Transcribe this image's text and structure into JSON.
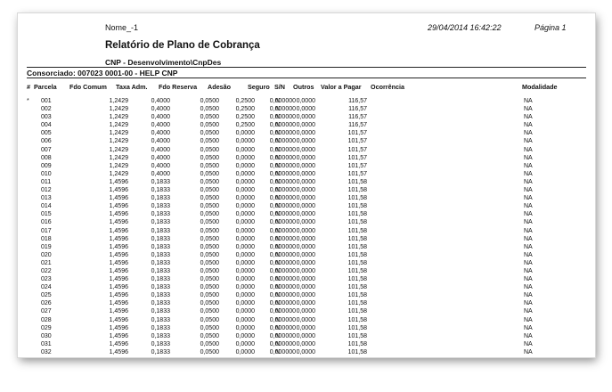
{
  "report": {
    "doc_name": "Nome_-1",
    "datetime": "29/04/2014 16:42:22",
    "page": "Página 1",
    "title": "Relatório de Plano de Cobrança",
    "subtitle": "CNP - Desenvolvimento\\CnpDes",
    "consorciado": "Consorciado: 007023 0001-00 - HELP CNP"
  },
  "columns": {
    "hash": "#",
    "parcela": "Parcela",
    "fdo_comum": "Fdo Comum",
    "taxa_adm": "Taxa Adm.",
    "fdo_reserva": "Fdo Reserva",
    "adesao": "Adesão",
    "seguro": "Seguro",
    "sn": "S/N",
    "outros": "Outros",
    "valor_pagar": "Valor a Pagar",
    "ocorrencia": "Ocorrência",
    "modalidade": "Modalidade"
  },
  "rows": [
    {
      "mark": "*",
      "parcela": "001",
      "fdo_comum": "1,2429",
      "taxa_adm": "0,4000",
      "fdo_reserva": "0,0500",
      "adesao": "0,2500",
      "seguro": "0,000000",
      "sn": "N",
      "outros": "0,0000",
      "valor": "116,57",
      "ocorrencia": "",
      "modalidade": "NA"
    },
    {
      "mark": "",
      "parcela": "002",
      "fdo_comum": "1,2429",
      "taxa_adm": "0,4000",
      "fdo_reserva": "0,0500",
      "adesao": "0,2500",
      "seguro": "0,000000",
      "sn": "N",
      "outros": "0,0000",
      "valor": "116,57",
      "ocorrencia": "",
      "modalidade": "NA"
    },
    {
      "mark": "",
      "parcela": "003",
      "fdo_comum": "1,2429",
      "taxa_adm": "0,4000",
      "fdo_reserva": "0,0500",
      "adesao": "0,2500",
      "seguro": "0,000000",
      "sn": "N",
      "outros": "0,0000",
      "valor": "116,57",
      "ocorrencia": "",
      "modalidade": "NA"
    },
    {
      "mark": "",
      "parcela": "004",
      "fdo_comum": "1,2429",
      "taxa_adm": "0,4000",
      "fdo_reserva": "0,0500",
      "adesao": "0,2500",
      "seguro": "0,000000",
      "sn": "N",
      "outros": "0,0000",
      "valor": "116,57",
      "ocorrencia": "",
      "modalidade": "NA"
    },
    {
      "mark": "",
      "parcela": "005",
      "fdo_comum": "1,2429",
      "taxa_adm": "0,4000",
      "fdo_reserva": "0,0500",
      "adesao": "0,0000",
      "seguro": "0,000000",
      "sn": "N",
      "outros": "0,0000",
      "valor": "101,57",
      "ocorrencia": "",
      "modalidade": "NA"
    },
    {
      "mark": "",
      "parcela": "006",
      "fdo_comum": "1,2429",
      "taxa_adm": "0,4000",
      "fdo_reserva": "0,0500",
      "adesao": "0,0000",
      "seguro": "0,000000",
      "sn": "N",
      "outros": "0,0000",
      "valor": "101,57",
      "ocorrencia": "",
      "modalidade": "NA"
    },
    {
      "mark": "",
      "parcela": "007",
      "fdo_comum": "1,2429",
      "taxa_adm": "0,4000",
      "fdo_reserva": "0,0500",
      "adesao": "0,0000",
      "seguro": "0,000000",
      "sn": "N",
      "outros": "0,0000",
      "valor": "101,57",
      "ocorrencia": "",
      "modalidade": "NA"
    },
    {
      "mark": "",
      "parcela": "008",
      "fdo_comum": "1,2429",
      "taxa_adm": "0,4000",
      "fdo_reserva": "0,0500",
      "adesao": "0,0000",
      "seguro": "0,000000",
      "sn": "N",
      "outros": "0,0000",
      "valor": "101,57",
      "ocorrencia": "",
      "modalidade": "NA"
    },
    {
      "mark": "",
      "parcela": "009",
      "fdo_comum": "1,2429",
      "taxa_adm": "0,4000",
      "fdo_reserva": "0,0500",
      "adesao": "0,0000",
      "seguro": "0,000000",
      "sn": "N",
      "outros": "0,0000",
      "valor": "101,57",
      "ocorrencia": "",
      "modalidade": "NA"
    },
    {
      "mark": "",
      "parcela": "010",
      "fdo_comum": "1,2429",
      "taxa_adm": "0,4000",
      "fdo_reserva": "0,0500",
      "adesao": "0,0000",
      "seguro": "0,000000",
      "sn": "N",
      "outros": "0,0000",
      "valor": "101,57",
      "ocorrencia": "",
      "modalidade": "NA"
    },
    {
      "mark": "",
      "parcela": "011",
      "fdo_comum": "1,4596",
      "taxa_adm": "0,1833",
      "fdo_reserva": "0,0500",
      "adesao": "0,0000",
      "seguro": "0,000000",
      "sn": "N",
      "outros": "0,0000",
      "valor": "101,58",
      "ocorrencia": "",
      "modalidade": "NA"
    },
    {
      "mark": "",
      "parcela": "012",
      "fdo_comum": "1,4596",
      "taxa_adm": "0,1833",
      "fdo_reserva": "0,0500",
      "adesao": "0,0000",
      "seguro": "0,000000",
      "sn": "N",
      "outros": "0,0000",
      "valor": "101,58",
      "ocorrencia": "",
      "modalidade": "NA"
    },
    {
      "mark": "",
      "parcela": "013",
      "fdo_comum": "1,4596",
      "taxa_adm": "0,1833",
      "fdo_reserva": "0,0500",
      "adesao": "0,0000",
      "seguro": "0,000000",
      "sn": "N",
      "outros": "0,0000",
      "valor": "101,58",
      "ocorrencia": "",
      "modalidade": "NA"
    },
    {
      "mark": "",
      "parcela": "014",
      "fdo_comum": "1,4596",
      "taxa_adm": "0,1833",
      "fdo_reserva": "0,0500",
      "adesao": "0,0000",
      "seguro": "0,000000",
      "sn": "N",
      "outros": "0,0000",
      "valor": "101,58",
      "ocorrencia": "",
      "modalidade": "NA"
    },
    {
      "mark": "",
      "parcela": "015",
      "fdo_comum": "1,4596",
      "taxa_adm": "0,1833",
      "fdo_reserva": "0,0500",
      "adesao": "0,0000",
      "seguro": "0,000000",
      "sn": "N",
      "outros": "0,0000",
      "valor": "101,58",
      "ocorrencia": "",
      "modalidade": "NA"
    },
    {
      "mark": "",
      "parcela": "016",
      "fdo_comum": "1,4596",
      "taxa_adm": "0,1833",
      "fdo_reserva": "0,0500",
      "adesao": "0,0000",
      "seguro": "0,000000",
      "sn": "N",
      "outros": "0,0000",
      "valor": "101,58",
      "ocorrencia": "",
      "modalidade": "NA"
    },
    {
      "mark": "",
      "parcela": "017",
      "fdo_comum": "1,4596",
      "taxa_adm": "0,1833",
      "fdo_reserva": "0,0500",
      "adesao": "0,0000",
      "seguro": "0,000000",
      "sn": "N",
      "outros": "0,0000",
      "valor": "101,58",
      "ocorrencia": "",
      "modalidade": "NA"
    },
    {
      "mark": "",
      "parcela": "018",
      "fdo_comum": "1,4596",
      "taxa_adm": "0,1833",
      "fdo_reserva": "0,0500",
      "adesao": "0,0000",
      "seguro": "0,000000",
      "sn": "N",
      "outros": "0,0000",
      "valor": "101,58",
      "ocorrencia": "",
      "modalidade": "NA"
    },
    {
      "mark": "",
      "parcela": "019",
      "fdo_comum": "1,4596",
      "taxa_adm": "0,1833",
      "fdo_reserva": "0,0500",
      "adesao": "0,0000",
      "seguro": "0,000000",
      "sn": "N",
      "outros": "0,0000",
      "valor": "101,58",
      "ocorrencia": "",
      "modalidade": "NA"
    },
    {
      "mark": "",
      "parcela": "020",
      "fdo_comum": "1,4596",
      "taxa_adm": "0,1833",
      "fdo_reserva": "0,0500",
      "adesao": "0,0000",
      "seguro": "0,000000",
      "sn": "N",
      "outros": "0,0000",
      "valor": "101,58",
      "ocorrencia": "",
      "modalidade": "NA"
    },
    {
      "mark": "",
      "parcela": "021",
      "fdo_comum": "1,4596",
      "taxa_adm": "0,1833",
      "fdo_reserva": "0,0500",
      "adesao": "0,0000",
      "seguro": "0,000000",
      "sn": "N",
      "outros": "0,0000",
      "valor": "101,58",
      "ocorrencia": "",
      "modalidade": "NA"
    },
    {
      "mark": "",
      "parcela": "022",
      "fdo_comum": "1,4596",
      "taxa_adm": "0,1833",
      "fdo_reserva": "0,0500",
      "adesao": "0,0000",
      "seguro": "0,000000",
      "sn": "N",
      "outros": "0,0000",
      "valor": "101,58",
      "ocorrencia": "",
      "modalidade": "NA"
    },
    {
      "mark": "",
      "parcela": "023",
      "fdo_comum": "1,4596",
      "taxa_adm": "0,1833",
      "fdo_reserva": "0,0500",
      "adesao": "0,0000",
      "seguro": "0,000000",
      "sn": "N",
      "outros": "0,0000",
      "valor": "101,58",
      "ocorrencia": "",
      "modalidade": "NA"
    },
    {
      "mark": "",
      "parcela": "024",
      "fdo_comum": "1,4596",
      "taxa_adm": "0,1833",
      "fdo_reserva": "0,0500",
      "adesao": "0,0000",
      "seguro": "0,000000",
      "sn": "N",
      "outros": "0,0000",
      "valor": "101,58",
      "ocorrencia": "",
      "modalidade": "NA"
    },
    {
      "mark": "",
      "parcela": "025",
      "fdo_comum": "1,4596",
      "taxa_adm": "0,1833",
      "fdo_reserva": "0,0500",
      "adesao": "0,0000",
      "seguro": "0,000000",
      "sn": "N",
      "outros": "0,0000",
      "valor": "101,58",
      "ocorrencia": "",
      "modalidade": "NA"
    },
    {
      "mark": "",
      "parcela": "026",
      "fdo_comum": "1,4596",
      "taxa_adm": "0,1833",
      "fdo_reserva": "0,0500",
      "adesao": "0,0000",
      "seguro": "0,000000",
      "sn": "N",
      "outros": "0,0000",
      "valor": "101,58",
      "ocorrencia": "",
      "modalidade": "NA"
    },
    {
      "mark": "",
      "parcela": "027",
      "fdo_comum": "1,4596",
      "taxa_adm": "0,1833",
      "fdo_reserva": "0,0500",
      "adesao": "0,0000",
      "seguro": "0,000000",
      "sn": "N",
      "outros": "0,0000",
      "valor": "101,58",
      "ocorrencia": "",
      "modalidade": "NA"
    },
    {
      "mark": "",
      "parcela": "028",
      "fdo_comum": "1,4596",
      "taxa_adm": "0,1833",
      "fdo_reserva": "0,0500",
      "adesao": "0,0000",
      "seguro": "0,000000",
      "sn": "N",
      "outros": "0,0000",
      "valor": "101,58",
      "ocorrencia": "",
      "modalidade": "NA"
    },
    {
      "mark": "",
      "parcela": "029",
      "fdo_comum": "1,4596",
      "taxa_adm": "0,1833",
      "fdo_reserva": "0,0500",
      "adesao": "0,0000",
      "seguro": "0,000000",
      "sn": "N",
      "outros": "0,0000",
      "valor": "101,58",
      "ocorrencia": "",
      "modalidade": "NA"
    },
    {
      "mark": "",
      "parcela": "030",
      "fdo_comum": "1,4596",
      "taxa_adm": "0,1833",
      "fdo_reserva": "0,0500",
      "adesao": "0,0000",
      "seguro": "0,000000",
      "sn": "N",
      "outros": "0,0000",
      "valor": "101,58",
      "ocorrencia": "",
      "modalidade": "NA"
    },
    {
      "mark": "",
      "parcela": "031",
      "fdo_comum": "1,4596",
      "taxa_adm": "0,1833",
      "fdo_reserva": "0,0500",
      "adesao": "0,0000",
      "seguro": "0,000000",
      "sn": "N",
      "outros": "0,0000",
      "valor": "101,58",
      "ocorrencia": "",
      "modalidade": "NA"
    },
    {
      "mark": "",
      "parcela": "032",
      "fdo_comum": "1,4596",
      "taxa_adm": "0,1833",
      "fdo_reserva": "0,0500",
      "adesao": "0,0000",
      "seguro": "0,000000",
      "sn": "N",
      "outros": "0,0000",
      "valor": "101,58",
      "ocorrencia": "",
      "modalidade": "NA"
    }
  ]
}
